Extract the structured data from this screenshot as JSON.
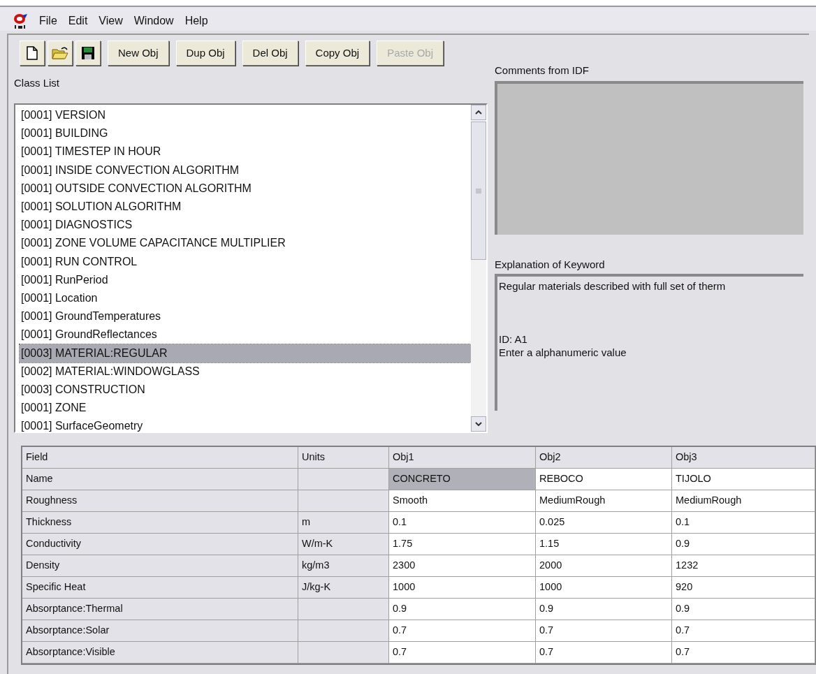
{
  "menu": [
    {
      "label": "File"
    },
    {
      "label": "Edit"
    },
    {
      "label": "View"
    },
    {
      "label": "Window"
    },
    {
      "label": "Help"
    }
  ],
  "toolbar": {
    "buttons": [
      {
        "label": "New Obj",
        "disabled": false
      },
      {
        "label": "Dup Obj",
        "disabled": false
      },
      {
        "label": "Del Obj",
        "disabled": false
      },
      {
        "label": "Copy Obj",
        "disabled": false
      },
      {
        "label": "Paste Obj",
        "disabled": true
      }
    ]
  },
  "class_list": {
    "label": "Class List",
    "items": [
      {
        "text": "[0001] VERSION",
        "selected": false
      },
      {
        "text": "[0001] BUILDING",
        "selected": false
      },
      {
        "text": "[0001] TIMESTEP IN HOUR",
        "selected": false
      },
      {
        "text": "[0001] INSIDE CONVECTION ALGORITHM",
        "selected": false
      },
      {
        "text": "[0001] OUTSIDE CONVECTION ALGORITHM",
        "selected": false
      },
      {
        "text": "[0001] SOLUTION ALGORITHM",
        "selected": false
      },
      {
        "text": "[0001] DIAGNOSTICS",
        "selected": false
      },
      {
        "text": "[0001] ZONE VOLUME CAPACITANCE MULTIPLIER",
        "selected": false
      },
      {
        "text": "[0001] RUN CONTROL",
        "selected": false
      },
      {
        "text": "[0001] RunPeriod",
        "selected": false
      },
      {
        "text": "[0001] Location",
        "selected": false
      },
      {
        "text": "[0001] GroundTemperatures",
        "selected": false
      },
      {
        "text": "[0001] GroundReflectances",
        "selected": false
      },
      {
        "text": "[0003] MATERIAL:REGULAR",
        "selected": true
      },
      {
        "text": "[0002] MATERIAL:WINDOWGLASS",
        "selected": false
      },
      {
        "text": "[0003] CONSTRUCTION",
        "selected": false
      },
      {
        "text": "[0001] ZONE",
        "selected": false
      },
      {
        "text": "[0001] SurfaceGeometry",
        "selected": false
      }
    ]
  },
  "comments": {
    "label": "Comments from IDF"
  },
  "explanation": {
    "label": "Explanation of Keyword",
    "paragraphs": [
      {
        "lines": [
          "Regular materials described with full set of therm"
        ]
      },
      {
        "lines": [
          "ID: A1",
          "Enter a alphanumeric value"
        ]
      }
    ]
  },
  "grid": {
    "columns": [
      "Field",
      "Units",
      "Obj1",
      "Obj2",
      "Obj3"
    ],
    "rows": [
      {
        "field": "Name",
        "values": [
          {
            "text": "CONCRETO",
            "selected": true
          },
          {
            "text": "REBOCO",
            "selected": false
          },
          {
            "text": "TIJOLO",
            "selected": false
          }
        ]
      },
      {
        "field": "Roughness",
        "values": [
          {
            "text": "Smooth",
            "selected": false
          },
          {
            "text": "MediumRough",
            "selected": false
          },
          {
            "text": "MediumRough",
            "selected": false
          }
        ]
      },
      {
        "field": "Thickness",
        "units": "m",
        "values": [
          {
            "text": "0.1",
            "selected": false
          },
          {
            "text": "0.025",
            "selected": false
          },
          {
            "text": "0.1",
            "selected": false
          }
        ]
      },
      {
        "field": "Conductivity",
        "units": "W/m-K",
        "values": [
          {
            "text": "1.75",
            "selected": false
          },
          {
            "text": "1.15",
            "selected": false
          },
          {
            "text": "0.9",
            "selected": false
          }
        ]
      },
      {
        "field": "Density",
        "units": "kg/m3",
        "values": [
          {
            "text": "2300",
            "selected": false
          },
          {
            "text": "2000",
            "selected": false
          },
          {
            "text": "1232",
            "selected": false
          }
        ]
      },
      {
        "field": "Specific Heat",
        "units": "J/kg-K",
        "values": [
          {
            "text": "1000",
            "selected": false
          },
          {
            "text": "1000",
            "selected": false
          },
          {
            "text": "920",
            "selected": false
          }
        ]
      },
      {
        "field": "Absorptance:Thermal",
        "values": [
          {
            "text": "0.9",
            "selected": false
          },
          {
            "text": "0.9",
            "selected": false
          },
          {
            "text": "0.9",
            "selected": false
          }
        ]
      },
      {
        "field": "Absorptance:Solar",
        "values": [
          {
            "text": "0.7",
            "selected": false
          },
          {
            "text": "0.7",
            "selected": false
          },
          {
            "text": "0.7",
            "selected": false
          }
        ]
      },
      {
        "field": "Absorptance:Visible",
        "values": [
          {
            "text": "0.7",
            "selected": false
          },
          {
            "text": "0.7",
            "selected": false
          },
          {
            "text": "0.7",
            "selected": false
          }
        ]
      }
    ]
  }
}
